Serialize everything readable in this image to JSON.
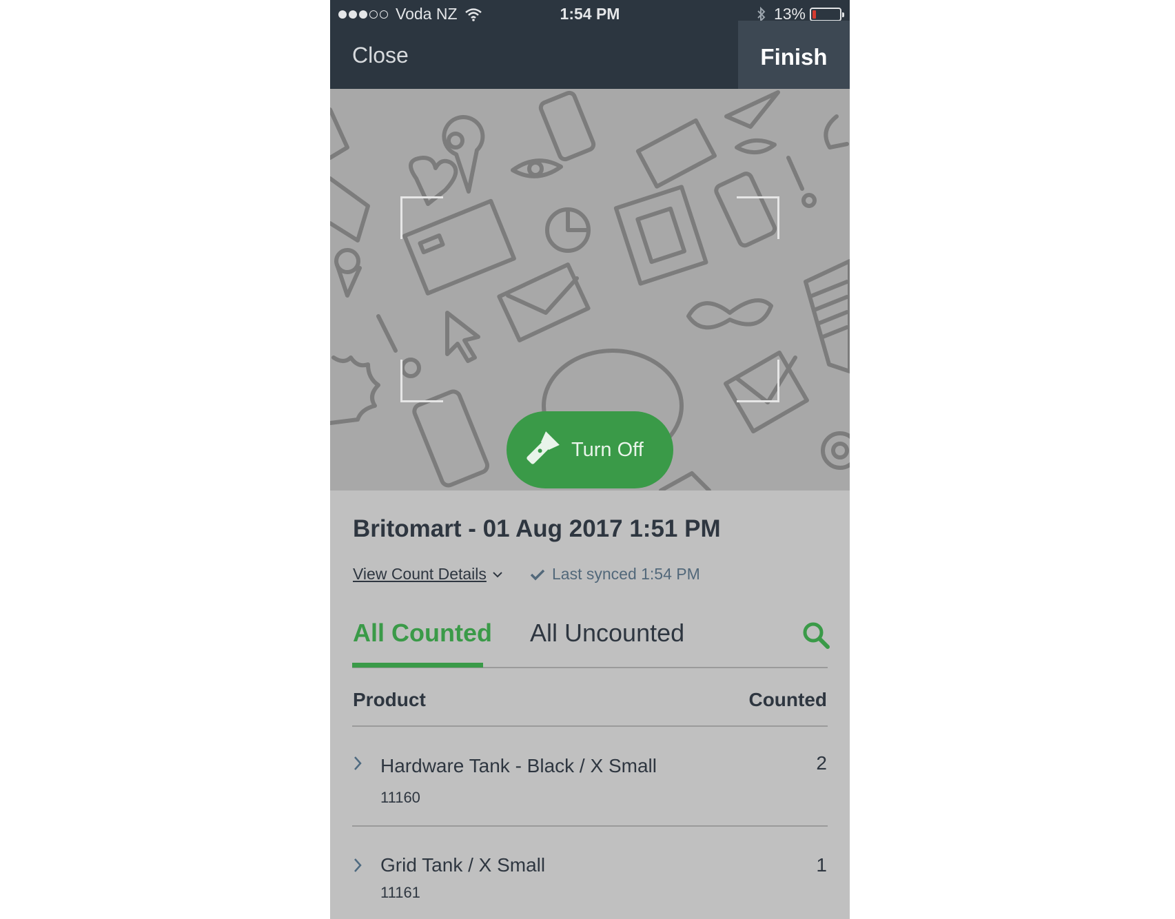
{
  "status_bar": {
    "carrier": "Voda NZ",
    "time": "1:54 PM",
    "battery": "13%",
    "battery_level": 0.13,
    "signal_bars": 3,
    "signal_max": 5
  },
  "nav": {
    "close_label": "Close",
    "finish_label": "Finish"
  },
  "camera": {
    "torch_label": "Turn Off"
  },
  "count": {
    "title": "Britomart - 01 Aug 2017 1:51 PM",
    "details_link": "View Count Details",
    "sync_status": "Last synced 1:54 PM"
  },
  "tabs": {
    "counted": "All Counted",
    "uncounted": "All Uncounted"
  },
  "table": {
    "header_product": "Product",
    "header_counted": "Counted",
    "rows": [
      {
        "name": "Hardware Tank - Black / X Small",
        "sku": "11160",
        "count": "2"
      },
      {
        "name": "Grid Tank / X Small",
        "sku": "11161",
        "count": "1"
      }
    ]
  },
  "colors": {
    "nav_bg": "#2c3640",
    "accent_green": "#3a9a48",
    "overlay_gray": "#c0c0c0",
    "battery_low": "#d43a2f"
  }
}
